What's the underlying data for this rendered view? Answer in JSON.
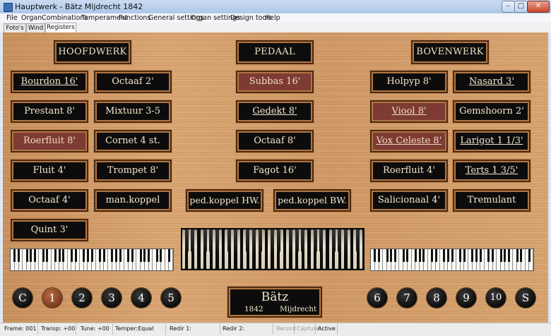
{
  "window": {
    "title": "Hauptwerk - Bätz Mijdrecht 1842",
    "min_glyph": "–",
    "max_glyph": "□",
    "close_glyph": "✕",
    "icon": "hauptwerk-app-icon"
  },
  "menu": [
    "File",
    "Organ",
    "Combinations",
    "Temperament",
    "Functions",
    "General settings",
    "Organ settings",
    "Design tools",
    "Help"
  ],
  "tabs": [
    {
      "label": "Foto's",
      "active": false
    },
    {
      "label": "Wind",
      "active": false
    },
    {
      "label": "Registers",
      "active": true
    }
  ],
  "divisions": {
    "hoofdwerk": "HOOFDWERK",
    "pedaal": "PEDAAL",
    "bovenwerk": "BOVENWERK"
  },
  "stops": {
    "hw_col1": [
      {
        "label": "Bourdon 16'",
        "on": false,
        "underline": true
      },
      {
        "label": "Prestant 8'",
        "on": false,
        "underline": false
      },
      {
        "label": "Roerfluit 8'",
        "on": true,
        "underline": false
      },
      {
        "label": "Fluit 4'",
        "on": false,
        "underline": false
      },
      {
        "label": "Octaaf 4'",
        "on": false,
        "underline": false
      },
      {
        "label": "Quint 3'",
        "on": false,
        "underline": false
      }
    ],
    "hw_col2": [
      {
        "label": "Octaaf 2'",
        "on": false,
        "underline": false
      },
      {
        "label": "Mixtuur 3-5",
        "on": false,
        "underline": false
      },
      {
        "label": "Cornet 4 st.",
        "on": false,
        "underline": false
      },
      {
        "label": "Trompet 8'",
        "on": false,
        "underline": false
      },
      {
        "label": "man.koppel",
        "on": false,
        "underline": false
      }
    ],
    "pedaal": [
      {
        "label": "Subbas 16'",
        "on": true,
        "underline": false
      },
      {
        "label": "Gedekt 8'",
        "on": false,
        "underline": true
      },
      {
        "label": "Octaaf 8'",
        "on": false,
        "underline": false
      },
      {
        "label": "Fagot 16'",
        "on": false,
        "underline": false
      }
    ],
    "couplers": [
      {
        "label": "ped.koppel HW.",
        "on": false,
        "underline": false
      },
      {
        "label": "ped.koppel BW.",
        "on": false,
        "underline": false
      }
    ],
    "bw_col1": [
      {
        "label": "Holpyp 8'",
        "on": false,
        "underline": false
      },
      {
        "label": "Viool 8'",
        "on": true,
        "underline": true
      },
      {
        "label": "Vox Celeste 8'",
        "on": true,
        "underline": true
      },
      {
        "label": "Roerfluit 4'",
        "on": false,
        "underline": false
      },
      {
        "label": "Salicionaal 4'",
        "on": false,
        "underline": false
      }
    ],
    "bw_col2": [
      {
        "label": "Nasard 3'",
        "on": false,
        "underline": true
      },
      {
        "label": "Gemshoorn 2'",
        "on": false,
        "underline": false
      },
      {
        "label": "Larigot 1 1/3'",
        "on": false,
        "underline": true
      },
      {
        "label": "Terts 1 3/5'",
        "on": false,
        "underline": true
      },
      {
        "label": "Tremulant",
        "on": false,
        "underline": false
      }
    ]
  },
  "pistons_left": [
    {
      "label": "C",
      "selected": false
    },
    {
      "label": "1",
      "selected": true
    },
    {
      "label": "2",
      "selected": false
    },
    {
      "label": "3",
      "selected": false
    },
    {
      "label": "4",
      "selected": false
    },
    {
      "label": "5",
      "selected": false
    }
  ],
  "pistons_right": [
    {
      "label": "6",
      "selected": false
    },
    {
      "label": "7",
      "selected": false
    },
    {
      "label": "8",
      "selected": false
    },
    {
      "label": "9",
      "selected": false
    },
    {
      "label": "10",
      "selected": false
    },
    {
      "label": "S",
      "selected": false
    }
  ],
  "nameplate": {
    "name": "Bätz",
    "year": "1842",
    "place": "Mijdrecht"
  },
  "status": {
    "frame": "Frame: 001",
    "transp": "Transp: +00",
    "tune": "Tune: +00",
    "temper": "Temper:Equal",
    "redir1": "Redir 1:",
    "redir2": "Redir 2:",
    "record": "Record",
    "capture": "Capture",
    "active": "Active"
  },
  "colors": {
    "stop_off": "#0c0c0c",
    "stop_on": "#7d3b34",
    "plate_text": "#f4e6cc",
    "wood": "#d3a06d",
    "piston_selected": "#7a3a1e"
  }
}
